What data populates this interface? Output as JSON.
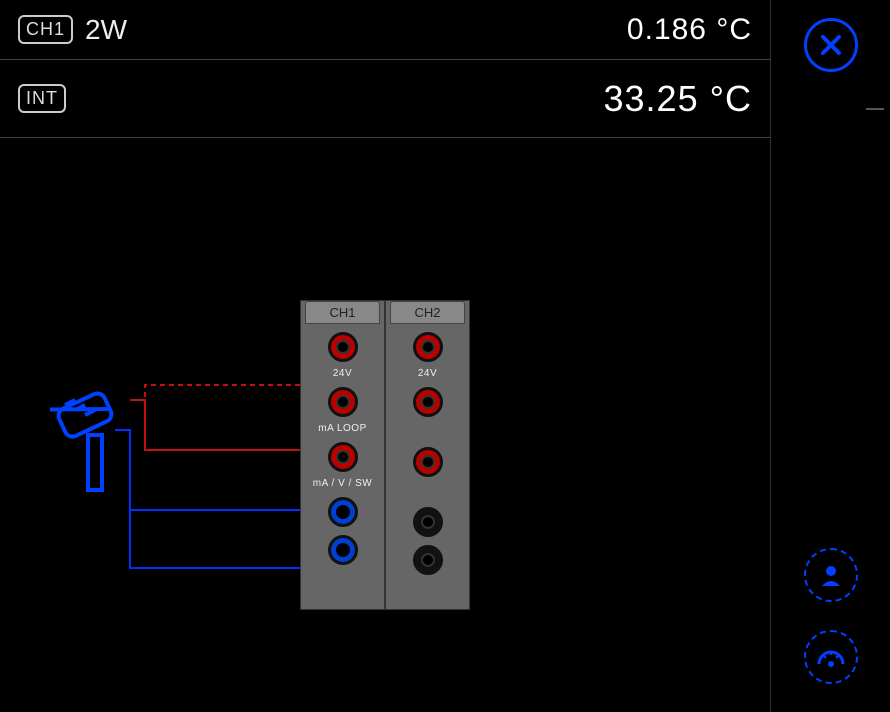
{
  "readings": {
    "ch1": {
      "badge": "CH1",
      "mode": "2W",
      "value": "0.186 °C"
    },
    "int": {
      "badge": "INT",
      "value": "33.25 °C"
    }
  },
  "panel": {
    "col1": "CH1",
    "col2": "CH2",
    "label24v": "24V",
    "labelMaLoop": "mA LOOP",
    "labelMaVsw": "mA / V / SW"
  },
  "colors": {
    "accent_blue": "#0040ff",
    "jack_red": "#b00000",
    "wire_red": "#c01010",
    "wire_blue": "#0030ff"
  },
  "sidebar": {
    "close": "close",
    "user": "user",
    "auto": "auto"
  }
}
